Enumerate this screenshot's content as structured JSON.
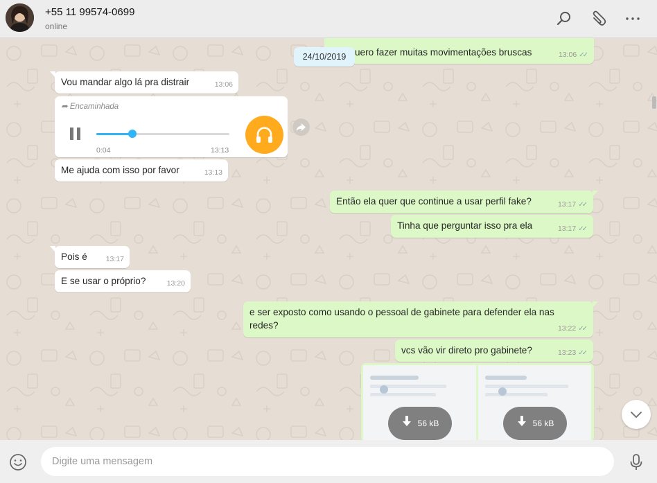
{
  "header": {
    "contact_name": "+55 11 99574-0699",
    "status": "online",
    "icons": [
      "search-icon",
      "attach-icon",
      "menu-icon"
    ]
  },
  "chat": {
    "date_chip": "24/10/2019",
    "messages": [
      {
        "dir": "out",
        "text": "uero fazer muitas movimentações bruscas",
        "time": "13:06",
        "ticks": "✓✓"
      },
      {
        "dir": "in",
        "text": "Vou mandar algo lá pra distrair",
        "time": "13:06"
      },
      {
        "dir": "in",
        "text": "Me ajuda com isso por favor",
        "time": "13:13"
      },
      {
        "dir": "out",
        "text": "Então ela quer que continue a usar perfil fake?",
        "time": "13:17",
        "ticks": "✓✓"
      },
      {
        "dir": "out",
        "text": "Tinha que perguntar isso pra ela",
        "time": "13:17",
        "ticks": "✓✓"
      },
      {
        "dir": "in",
        "text": "Pois é",
        "time": "13:17"
      },
      {
        "dir": "in",
        "text": "E se usar o próprio?",
        "time": "13:20"
      },
      {
        "dir": "out",
        "text": "e ser exposto como usando o pessoal de gabinete para defender ela nas redes?",
        "time": "13:22",
        "ticks": "✓✓"
      },
      {
        "dir": "out",
        "text": "vcs vão vir direto pro gabinete?",
        "time": "13:23",
        "ticks": "✓✓"
      }
    ],
    "audio": {
      "forwarded_label": "Encaminhada",
      "elapsed": "0:04",
      "time": "13:13",
      "progress": 0.27
    },
    "images": [
      {
        "size": "56 kB"
      },
      {
        "size": "56 kB"
      }
    ]
  },
  "footer": {
    "placeholder": "Digite uma mensagem"
  }
}
